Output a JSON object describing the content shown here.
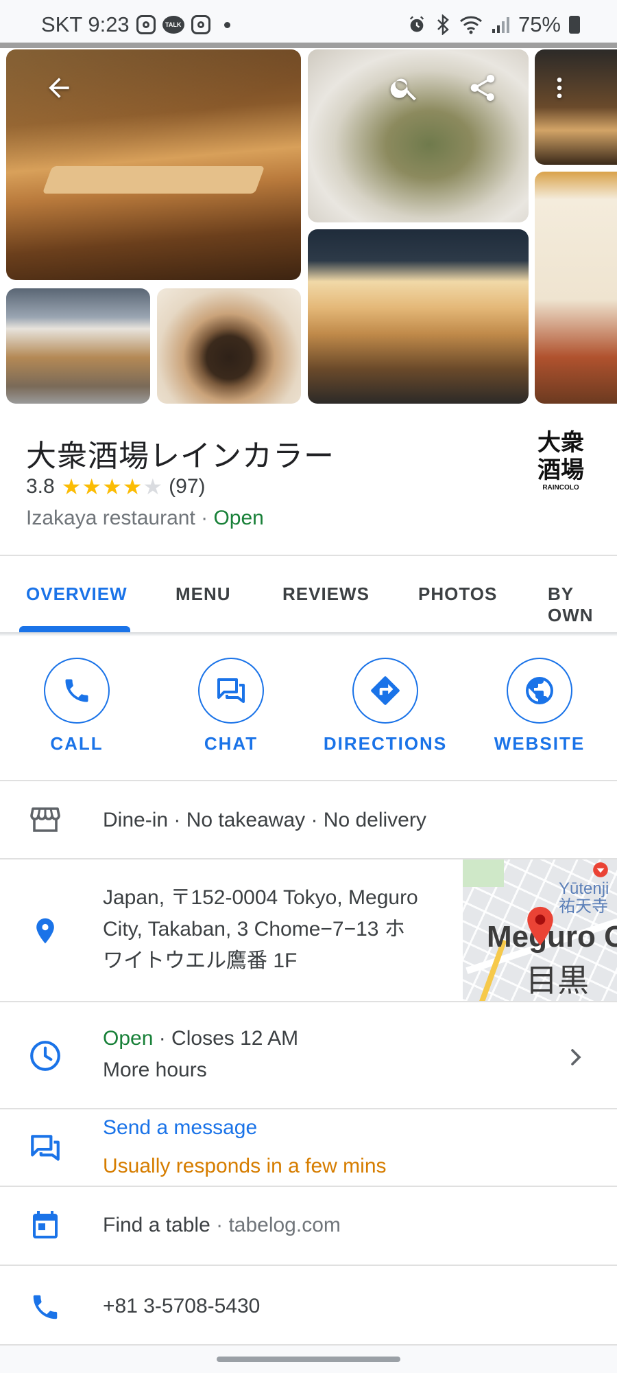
{
  "status_bar": {
    "carrier_time": "SKT 9:23",
    "notif_talk": "TALK",
    "battery": "75%"
  },
  "place": {
    "name": "大衆酒場レインカラー",
    "rating": "3.8",
    "rating_stars": 3.8,
    "review_count": "(97)",
    "category": "Izakaya restaurant",
    "separator": "·",
    "open_status": "Open",
    "logo_line1": "大衆",
    "logo_line2": "酒場",
    "logo_sub": "RAINCOLO"
  },
  "tabs": [
    {
      "label": "OVERVIEW",
      "active": true
    },
    {
      "label": "MENU"
    },
    {
      "label": "REVIEWS"
    },
    {
      "label": "PHOTOS"
    },
    {
      "label": "BY OWN"
    }
  ],
  "actions": [
    {
      "label": "CALL",
      "icon": "phone-icon"
    },
    {
      "label": "CHAT",
      "icon": "chat-icon"
    },
    {
      "label": "DIRECTIONS",
      "icon": "directions-icon"
    },
    {
      "label": "WEBSITE",
      "icon": "globe-icon"
    }
  ],
  "service_options": "Dine-in · No takeaway · No delivery",
  "address": {
    "line1": "Japan, 〒152-0004 Tokyo, Meguro",
    "line2": "City, Takaban, 3 Chome−7−13 ホ",
    "line3": "ワイトウエル鷹番 1F",
    "map_label_en": "Meguro C",
    "map_label_jp": "目黒区",
    "map_poi_en": "Yūtenji",
    "map_poi_jp": "祐天寺"
  },
  "hours": {
    "open": "Open",
    "closes": " · Closes 12 AM",
    "more": "More hours"
  },
  "message": {
    "label": "Send a message",
    "response": "Usually responds in a few mins"
  },
  "reservation": {
    "label": "Find a table",
    "source": " · tabelog.com"
  },
  "phone": "+81 3-5708-5430",
  "colors": {
    "accent": "#1a73e8",
    "open_green": "#188038",
    "star": "#fbbc04",
    "response_orange": "#d67d00"
  }
}
